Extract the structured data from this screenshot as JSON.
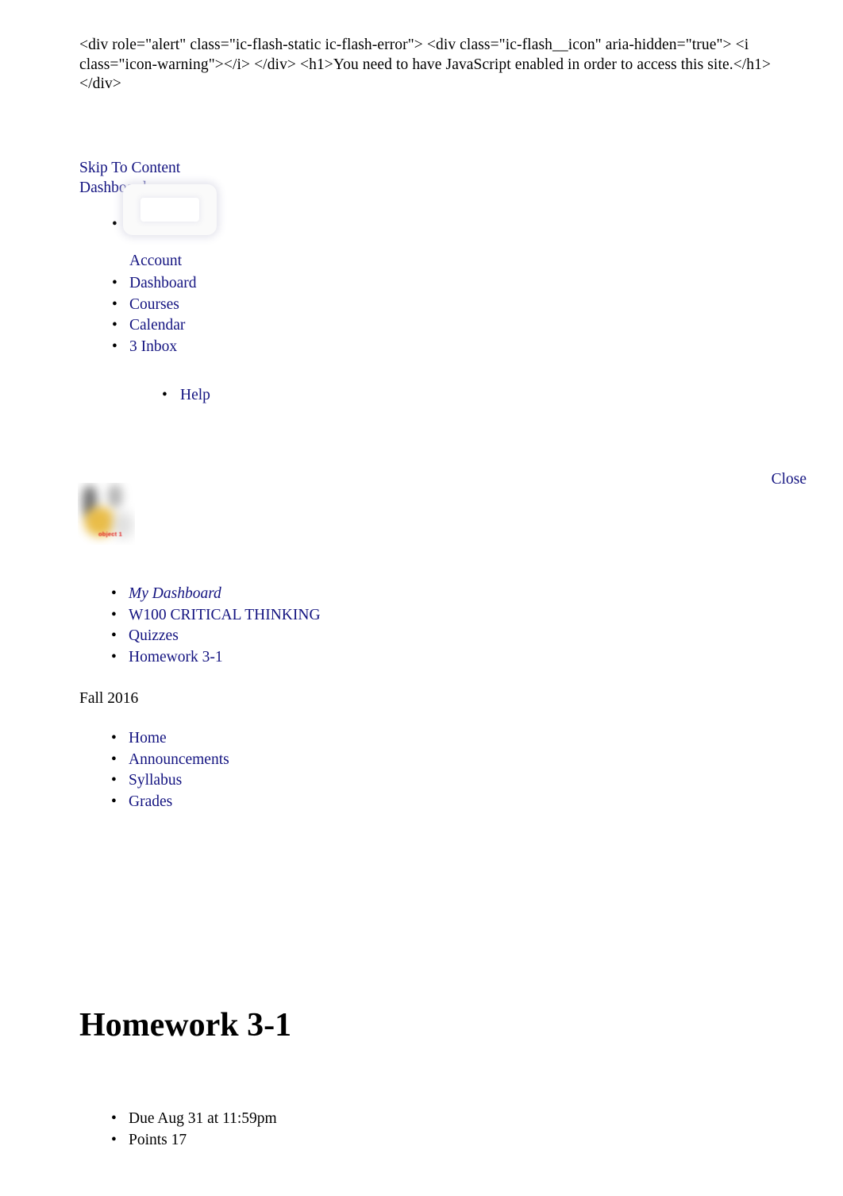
{
  "flash": {
    "raw_markup": "<div role=\"alert\" class=\"ic-flash-static ic-flash-error\"> <div class=\"ic-flash__icon\" aria-hidden=\"true\"> <i class=\"icon-warning\"></i> </div> <h1>You need to have JavaScript enabled in order to access this site.</h1> </div>"
  },
  "top_links": {
    "skip_to_content": "Skip To Content",
    "dashboard": "Dashboard"
  },
  "global_nav": {
    "account": "Account",
    "dashboard": "Dashboard",
    "courses": "Courses",
    "calendar": "Calendar",
    "inbox_count": "3",
    "inbox": "Inbox",
    "help": "Help"
  },
  "tray": {
    "close": "Close",
    "thumbnail_caption": "object 1"
  },
  "breadcrumbs": [
    {
      "label": "My Dashboard",
      "italic": true
    },
    {
      "label": "W100 CRITICAL THINKING",
      "italic": false
    },
    {
      "label": "Quizzes",
      "italic": false
    },
    {
      "label": "Homework 3-1",
      "italic": false
    }
  ],
  "course": {
    "term": "Fall 2016",
    "nav": [
      "Home",
      "Announcements",
      "Syllabus",
      "Grades"
    ]
  },
  "assignment": {
    "title": "Homework 3-1",
    "due": "Due Aug 31 at 11:59pm",
    "points": "Points 17"
  },
  "colors": {
    "link": "#131380",
    "text": "#000000",
    "caption_red": "#e01b1b",
    "background": "#ffffff"
  }
}
